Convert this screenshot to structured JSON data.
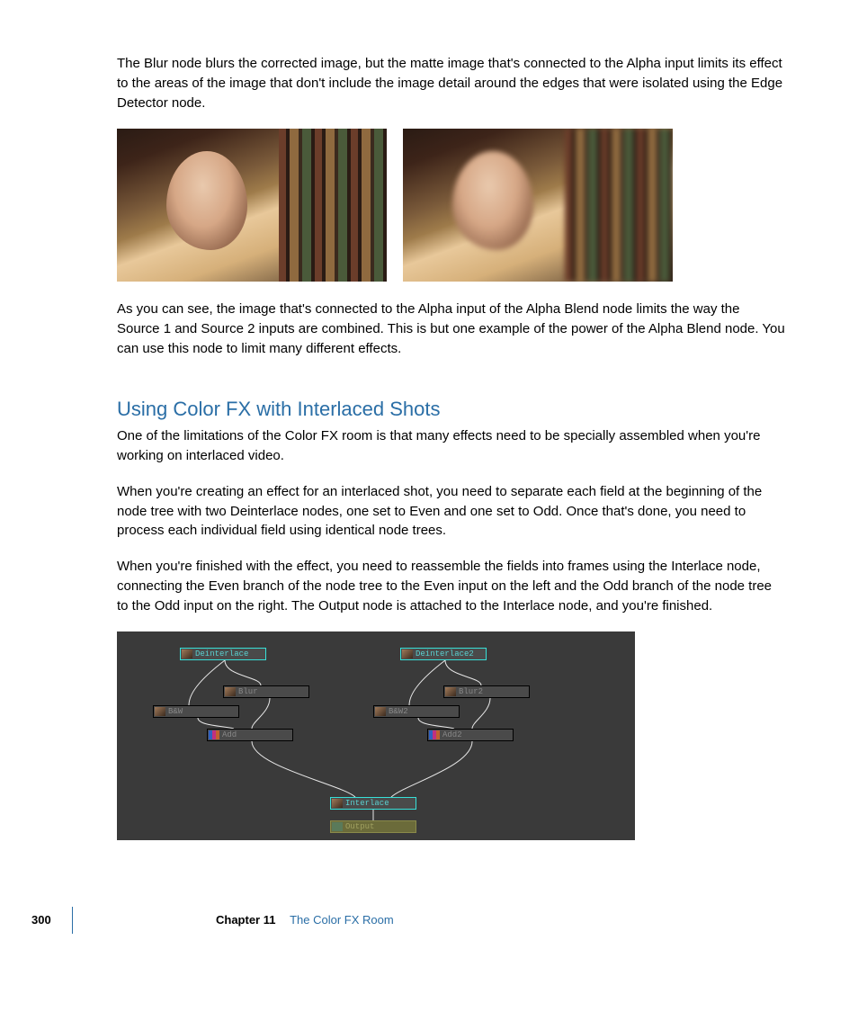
{
  "para1": "The Blur node blurs the corrected image, but the matte image that's connected to the Alpha input limits its effect to the areas of the image that don't include the image detail around the edges that were isolated using the Edge Detector node.",
  "para2": "As you can see, the image that's connected to the Alpha input of the Alpha Blend node limits the way the Source 1 and Source 2 inputs are combined. This is but one example of the power of the Alpha Blend node. You can use this node to limit many different effects.",
  "section_heading": "Using Color FX with Interlaced Shots",
  "para3": "One of the limitations of the Color FX room is that many effects need to be specially assembled when you're working on interlaced video.",
  "para4": "When you're creating an effect for an interlaced shot, you need to separate each field at the beginning of the node tree with two Deinterlace nodes, one set to Even and one set to Odd. Once that's done, you need to process each individual field using identical node trees.",
  "para5": "When you're finished with the effect, you need to reassemble the fields into frames using the Interlace node, connecting the Even branch of the node tree to the Even input on the left and the Odd branch of the node tree to the Odd input on the right. The Output node is attached to the Interlace node, and you're finished.",
  "nodes": {
    "deinterlace": "Deinterlace",
    "deinterlace2": "Deinterlace2",
    "blur": "Blur",
    "blur2": "Blur2",
    "bw": "B&W",
    "bw2": "B&W2",
    "add": "Add",
    "add2": "Add2",
    "interlace": "Interlace",
    "output": "Output"
  },
  "footer": {
    "page": "300",
    "chapter_label": "Chapter 11",
    "chapter_title": "The Color FX Room"
  }
}
